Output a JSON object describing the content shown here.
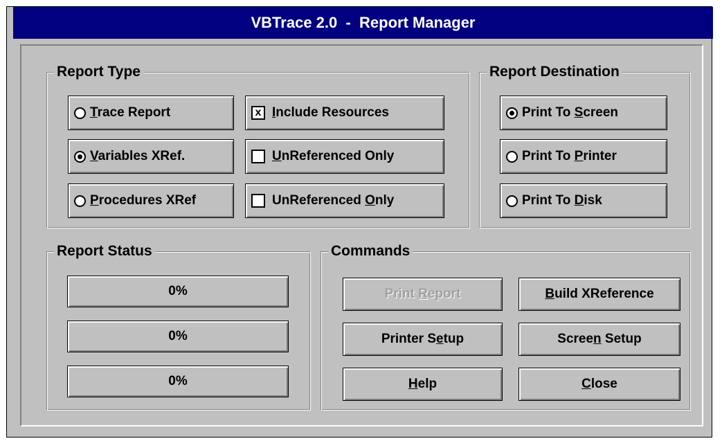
{
  "window": {
    "title": "VBTrace 2.0  -  Report Manager"
  },
  "report_type": {
    "legend": "Report Type",
    "options": [
      {
        "pre": "",
        "u": "T",
        "post": "race Report",
        "checked": false
      },
      {
        "pre": "",
        "u": "V",
        "post": "ariables XRef.",
        "checked": true
      },
      {
        "pre": "",
        "u": "P",
        "post": "rocedures XRef",
        "checked": false
      }
    ],
    "checkboxes": [
      {
        "pre": "",
        "u": "I",
        "post": "nclude Resources",
        "checked": true,
        "mark": "x"
      },
      {
        "pre": "",
        "u": "U",
        "post": "nReferenced Only",
        "checked": false,
        "mark": ""
      },
      {
        "pre": "UnReferenced ",
        "u": "O",
        "post": "nly",
        "checked": false,
        "mark": ""
      }
    ]
  },
  "report_destination": {
    "legend": "Report Destination",
    "options": [
      {
        "pre": "Print To ",
        "u": "S",
        "post": "creen",
        "checked": true
      },
      {
        "pre": "Print To ",
        "u": "P",
        "post": "rinter",
        "checked": false
      },
      {
        "pre": "Print To ",
        "u": "D",
        "post": "isk",
        "checked": false
      }
    ]
  },
  "report_status": {
    "legend": "Report Status",
    "progress": [
      {
        "label": "0%",
        "value": 0
      },
      {
        "label": "0%",
        "value": 0
      },
      {
        "label": "0%",
        "value": 0
      }
    ]
  },
  "commands": {
    "legend": "Commands",
    "print_report": {
      "pre": "Print ",
      "u": "R",
      "post": "eport",
      "enabled": false
    },
    "build_xref": {
      "pre": "",
      "u": "B",
      "post": "uild XReference"
    },
    "printer_setup": {
      "pre": "Printer S",
      "u": "e",
      "post": "tup"
    },
    "screen_setup": {
      "pre": "Scree",
      "u": "n",
      "post": " Setup"
    },
    "help": {
      "pre": "",
      "u": "H",
      "post": "elp"
    },
    "close": {
      "pre": "",
      "u": "C",
      "post": "lose"
    }
  }
}
